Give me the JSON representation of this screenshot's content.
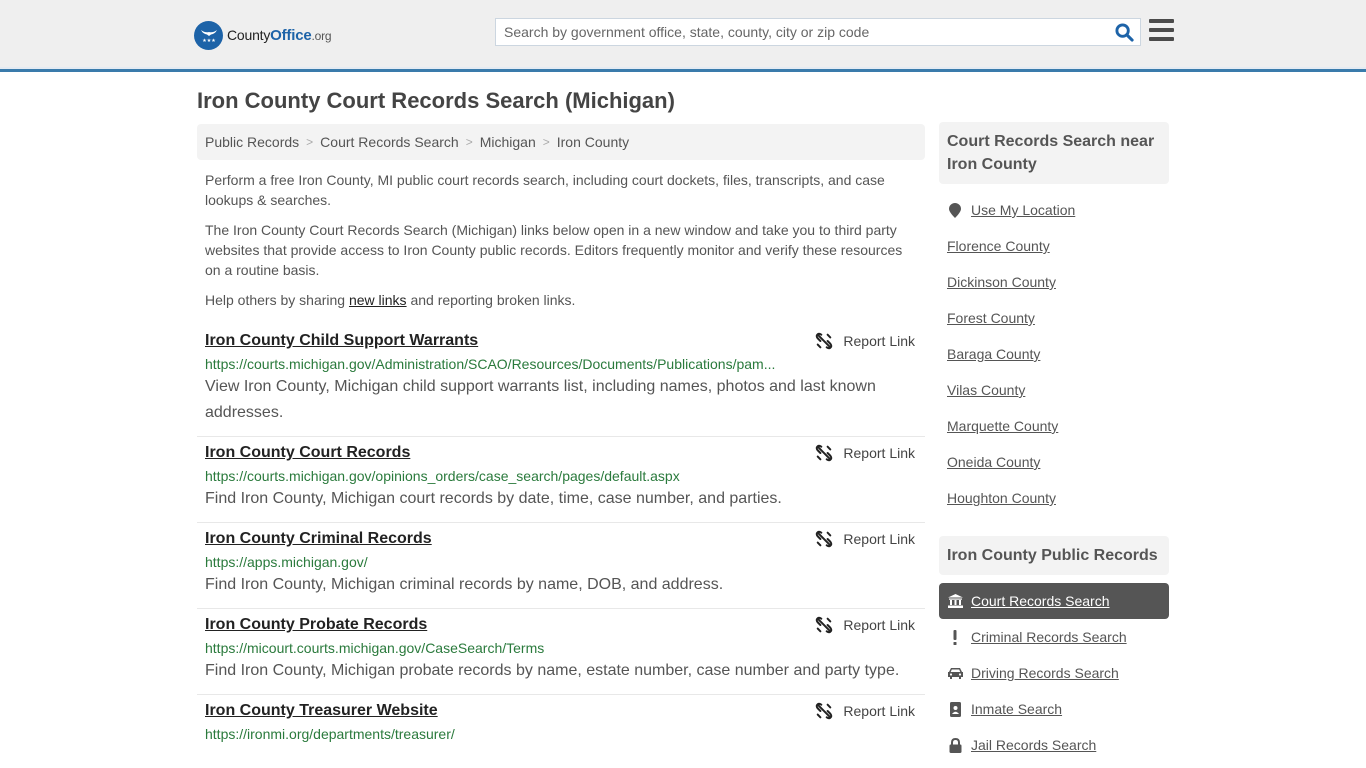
{
  "header": {
    "logo": {
      "name_part1": "County",
      "name_part2": "Office",
      "name_part3": ".org"
    },
    "search": {
      "placeholder": "Search by government office, state, county, city or zip code",
      "value": ""
    },
    "colors": {
      "brand": "#1d63a8",
      "header_bar": "#3a7bab"
    }
  },
  "main": {
    "title": "Iron County Court Records Search (Michigan)",
    "breadcrumb": [
      "Public Records",
      "Court Records Search",
      "Michigan",
      "Iron County"
    ],
    "intro": {
      "p1": "Perform a free Iron County, MI public court records search, including court dockets, files, transcripts, and case lookups & searches.",
      "p2": "The Iron County Court Records Search (Michigan) links below open in a new window and take you to third party websites that provide access to Iron County public records. Editors frequently monitor and verify these resources on a routine basis.",
      "p3_before": "Help others by sharing ",
      "p3_link": "new links",
      "p3_after": " and reporting broken links."
    },
    "report_label": "Report Link",
    "results": [
      {
        "title": "Iron County Child Support Warrants",
        "url": "https://courts.michigan.gov/Administration/SCAO/Resources/Documents/Publications/pam...",
        "desc": "View Iron County, Michigan child support warrants list, including names, photos and last known addresses."
      },
      {
        "title": "Iron County Court Records",
        "url": "https://courts.michigan.gov/opinions_orders/case_search/pages/default.aspx",
        "desc": "Find Iron County, Michigan court records by date, time, case number, and parties."
      },
      {
        "title": "Iron County Criminal Records",
        "url": "https://apps.michigan.gov/",
        "desc": "Find Iron County, Michigan criminal records by name, DOB, and address."
      },
      {
        "title": "Iron County Probate Records",
        "url": "https://micourt.courts.michigan.gov/CaseSearch/Terms",
        "desc": "Find Iron County, Michigan probate records by name, estate number, case number and party type."
      },
      {
        "title": "Iron County Treasurer Website",
        "url": "https://ironmi.org/departments/treasurer/",
        "desc": ""
      }
    ]
  },
  "sidebar": {
    "nearby_heading": "Court Records Search near Iron County",
    "use_location": "Use My Location",
    "nearby": [
      "Florence County",
      "Dickinson County",
      "Forest County",
      "Baraga County",
      "Vilas County",
      "Marquette County",
      "Oneida County",
      "Houghton County"
    ],
    "records_heading": "Iron County Public Records",
    "records": [
      {
        "label": "Court Records Search",
        "icon": "courthouse-icon",
        "active": true
      },
      {
        "label": "Criminal Records Search",
        "icon": "exclamation-icon",
        "active": false
      },
      {
        "label": "Driving Records Search",
        "icon": "car-icon",
        "active": false
      },
      {
        "label": "Inmate Search",
        "icon": "id-badge-icon",
        "active": false
      },
      {
        "label": "Jail Records Search",
        "icon": "lock-icon",
        "active": false
      }
    ]
  }
}
